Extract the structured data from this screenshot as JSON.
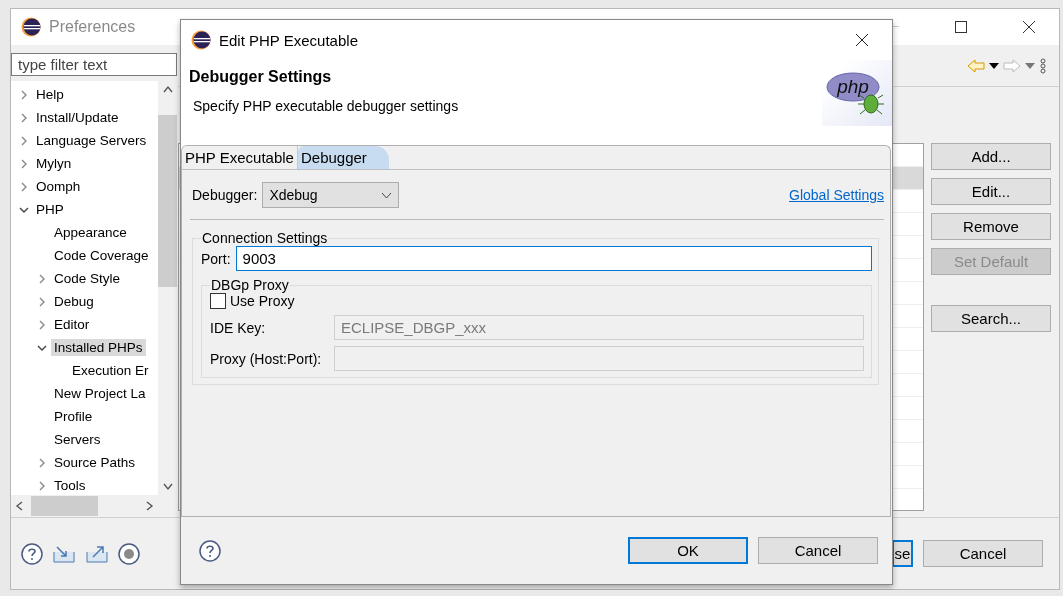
{
  "window": {
    "title": "Preferences"
  },
  "filter": {
    "placeholder": "type filter text"
  },
  "tree": [
    {
      "label": "Help",
      "kind": "folder",
      "expanded": false,
      "selected": false
    },
    {
      "label": "Install/Update",
      "kind": "folder",
      "expanded": false,
      "selected": false
    },
    {
      "label": "Language Servers",
      "kind": "folder",
      "expanded": false,
      "selected": false
    },
    {
      "label": "Mylyn",
      "kind": "folder",
      "expanded": false,
      "selected": false
    },
    {
      "label": "Oomph",
      "kind": "folder",
      "expanded": false,
      "selected": false
    },
    {
      "label": "PHP",
      "kind": "folder",
      "expanded": true,
      "selected": false,
      "children": [
        {
          "label": "Appearance",
          "kind": "page",
          "selected": false
        },
        {
          "label": "Code Coverage",
          "kind": "page",
          "selected": false
        },
        {
          "label": "Code Style",
          "kind": "folder",
          "expanded": false,
          "selected": false
        },
        {
          "label": "Debug",
          "kind": "folder",
          "expanded": false,
          "selected": false
        },
        {
          "label": "Editor",
          "kind": "folder",
          "expanded": false,
          "selected": false
        },
        {
          "label": "Installed PHPs",
          "kind": "folder",
          "expanded": true,
          "selected": true,
          "children": [
            {
              "label": "Execution Er",
              "kind": "page",
              "selected": false
            }
          ]
        },
        {
          "label": "New Project La",
          "kind": "page",
          "selected": false
        },
        {
          "label": "Profile",
          "kind": "page",
          "selected": false
        },
        {
          "label": "Servers",
          "kind": "page",
          "selected": false
        },
        {
          "label": "Source Paths",
          "kind": "folder",
          "expanded": false,
          "selected": false
        },
        {
          "label": "Tools",
          "kind": "folder",
          "expanded": false,
          "selected": false
        }
      ]
    }
  ],
  "table": {
    "rows": [
      {
        "selected": false
      },
      {
        "selected": true
      },
      {
        "selected": false
      },
      {
        "selected": false
      },
      {
        "selected": false
      },
      {
        "selected": false
      },
      {
        "selected": false
      },
      {
        "selected": false
      },
      {
        "selected": false
      },
      {
        "selected": false
      },
      {
        "selected": false
      },
      {
        "selected": false
      },
      {
        "selected": false
      },
      {
        "selected": false
      },
      {
        "selected": false
      }
    ]
  },
  "side_buttons": [
    {
      "label": "Add...",
      "disabled": false
    },
    {
      "label": "Edit...",
      "disabled": false
    },
    {
      "label": "Remove",
      "disabled": false
    },
    {
      "label": "Set Default",
      "disabled": true
    },
    {
      "label": "Search...",
      "disabled": false
    }
  ],
  "footer_buttons": [
    {
      "label": "se",
      "default": true
    },
    {
      "label": "Cancel",
      "default": false
    }
  ],
  "dialog": {
    "title": "Edit PHP Executable",
    "heading": "Debugger Settings",
    "description": "Specify PHP executable debugger settings",
    "logo_text": "php",
    "tabs": [
      {
        "label": "PHP Executable",
        "selected": false
      },
      {
        "label": "Debugger",
        "selected": true
      }
    ],
    "debugger_label": "Debugger:",
    "debugger_value": "Xdebug",
    "link": "Global Settings",
    "connection": {
      "title": "Connection Settings",
      "port_label": "Port:",
      "port_value": "9003",
      "focused": true
    },
    "proxy": {
      "title": "DBGp Proxy",
      "use_proxy": {
        "label": "Use Proxy",
        "checked": false
      },
      "fields": [
        {
          "label": "IDE Key:",
          "value": "ECLIPSE_DBGP_xxx",
          "disabled": true
        },
        {
          "label": "Proxy (Host:Port):",
          "disabled": true
        }
      ]
    },
    "buttons": [
      {
        "label": "OK",
        "default": true
      },
      {
        "label": "Cancel",
        "default": false
      }
    ]
  }
}
